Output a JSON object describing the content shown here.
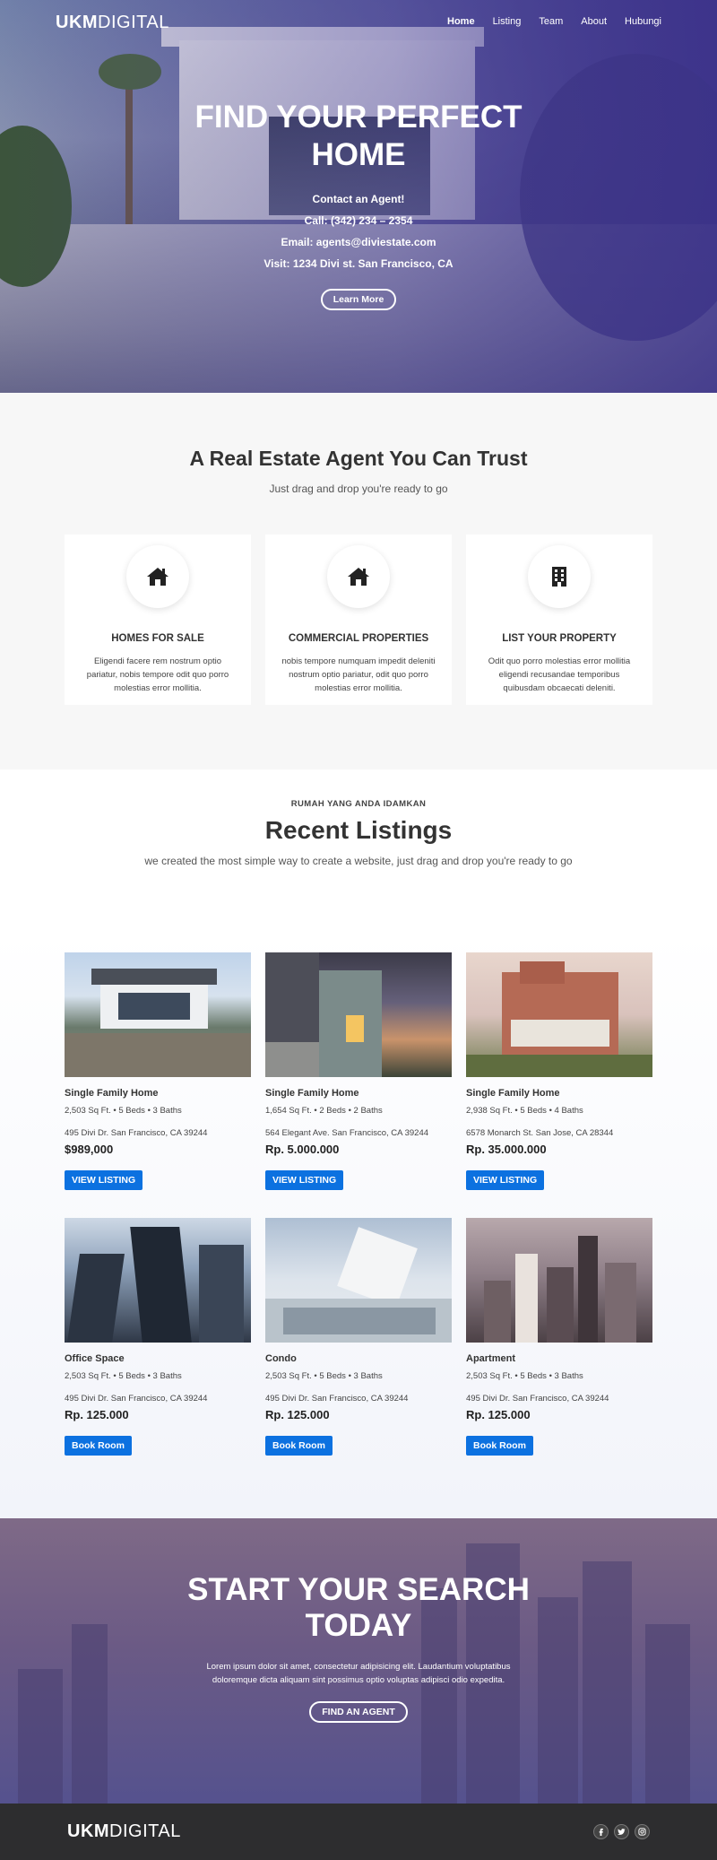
{
  "nav": {
    "logo_bold": "UKM",
    "logo_light": "DIGITAL",
    "items": [
      "Home",
      "Listing",
      "Team",
      "About",
      "Hubungi"
    ]
  },
  "hero": {
    "title": "FIND YOUR PERFECT HOME",
    "lines": [
      "Contact an Agent!",
      "Call: (342) 234 – 2354",
      "Email: agents@diviestate.com",
      "Visit: 1234 Divi st. San Francisco, CA"
    ],
    "button": "Learn More"
  },
  "trust": {
    "title": "A Real Estate Agent You Can Trust",
    "subtitle": "Just drag and drop you're ready to go",
    "cards": [
      {
        "icon": "home-icon",
        "title": "HOMES FOR SALE",
        "text": "Eligendi facere rem nostrum optio pariatur, nobis tempore odit quo porro molestias error mollitia."
      },
      {
        "icon": "home-icon",
        "title": "COMMERCIAL PROPERTIES",
        "text": "nobis tempore numquam impedit deleniti nostrum optio pariatur, odit quo porro molestias error mollitia."
      },
      {
        "icon": "building-icon",
        "title": "LIST YOUR PROPERTY",
        "text": "Odit quo porro molestias error mollitia eligendi recusandae temporibus quibusdam obcaecati deleniti."
      }
    ]
  },
  "listings": {
    "kicker": "RUMAH YANG ANDA IDAMKAN",
    "title": "Recent Listings",
    "subtitle": "we created the most simple way to create a website, just drag and drop you're ready to go",
    "items": [
      {
        "title": "Single Family Home",
        "meta": "2,503 Sq Ft. • 5 Beds • 3 Baths",
        "address": "495 Divi Dr. San Francisco, CA 39244",
        "price": "$989,000",
        "button": "VIEW LISTING"
      },
      {
        "title": "Single Family Home",
        "meta": "1,654 Sq Ft. • 2 Beds • 2 Baths",
        "address": "564 Elegant Ave. San Francisco, CA 39244",
        "price": "Rp. 5.000.000",
        "button": "VIEW LISTING"
      },
      {
        "title": "Single Family Home",
        "meta": "2,938 Sq Ft. • 5 Beds • 4 Baths",
        "address": "6578 Monarch St. San Jose, CA 28344",
        "price": "Rp. 35.000.000",
        "button": "VIEW LISTING"
      },
      {
        "title": "Office Space",
        "meta": "2,503 Sq Ft. • 5 Beds • 3 Baths",
        "address": "495 Divi Dr. San Francisco, CA 39244",
        "price": "Rp. 125.000",
        "button": "Book Room"
      },
      {
        "title": "Condo",
        "meta": "2,503 Sq Ft. • 5 Beds • 3 Baths",
        "address": "495 Divi Dr. San Francisco, CA 39244",
        "price": "Rp. 125.000",
        "button": "Book Room"
      },
      {
        "title": "Apartment",
        "meta": "2,503 Sq Ft. • 5 Beds • 3 Baths",
        "address": "495 Divi Dr. San Francisco, CA 39244",
        "price": "Rp. 125.000",
        "button": "Book Room"
      }
    ]
  },
  "cta": {
    "title": "START YOUR SEARCH TODAY",
    "text": "Lorem ipsum dolor sit amet, consectetur adipisicing elit. Laudantium voluptatibus doloremque dicta aliquam sint possimus optio voluptas adipisci odio expedita.",
    "button": "FIND AN AGENT"
  },
  "footer": {
    "logo_bold": "UKM",
    "logo_light": "DIGITAL",
    "socials": [
      "facebook-icon",
      "twitter-icon",
      "instagram-icon"
    ]
  },
  "colors": {
    "accent": "#0c71e0",
    "hero_overlay": "#463c8c",
    "footer_bg": "#2d2d2f"
  }
}
